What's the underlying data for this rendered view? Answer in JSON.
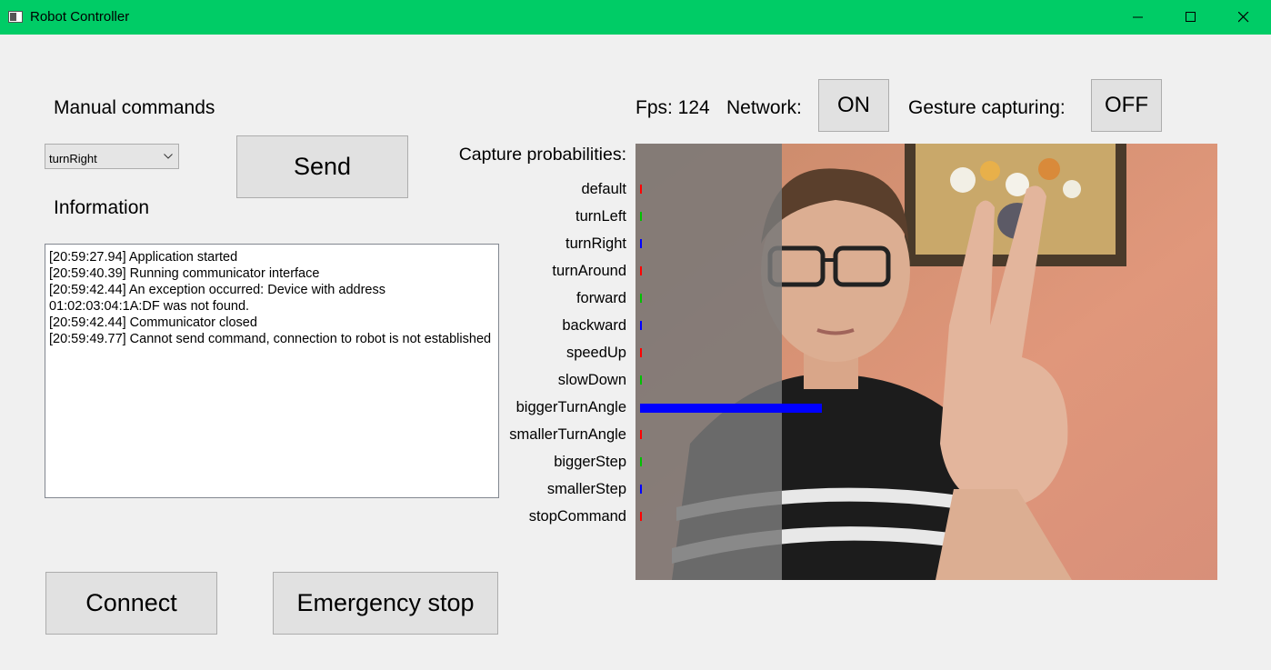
{
  "window": {
    "title": "Robot Controller"
  },
  "manual": {
    "heading": "Manual commands",
    "selected_command": "turnRight",
    "send_label": "Send"
  },
  "info": {
    "heading": "Information",
    "log": [
      "[20:59:27.94] Application started",
      "[20:59:40.39] Running communicator interface",
      "[20:59:42.44] An exception occurred: Device with address 01:02:03:04:1A:DF was not found.",
      "[20:59:42.44] Communicator closed",
      "[20:59:49.77] Cannot send command, connection to robot is not established"
    ]
  },
  "controls": {
    "connect_label": "Connect",
    "emergency_label": "Emergency stop"
  },
  "status": {
    "fps_text": "Fps: 124",
    "network_label": "Network:",
    "network_state": "ON",
    "gesture_label": "Gesture capturing:",
    "gesture_state": "OFF"
  },
  "capture": {
    "heading": "Capture probabilities:",
    "items": [
      {
        "label": "default",
        "value": 0.0,
        "color": "#ff0000"
      },
      {
        "label": "turnLeft",
        "value": 0.0,
        "color": "#00c000"
      },
      {
        "label": "turnRight",
        "value": 0.0,
        "color": "#0000ff"
      },
      {
        "label": "turnAround",
        "value": 0.0,
        "color": "#ff0000"
      },
      {
        "label": "forward",
        "value": 0.0,
        "color": "#00c000"
      },
      {
        "label": "backward",
        "value": 0.0,
        "color": "#0000ff"
      },
      {
        "label": "speedUp",
        "value": 0.0,
        "color": "#ff0000"
      },
      {
        "label": "slowDown",
        "value": 0.0,
        "color": "#00c000"
      },
      {
        "label": "biggerTurnAngle",
        "value": 1.0,
        "color": "#0000ff"
      },
      {
        "label": "smallerTurnAngle",
        "value": 0.0,
        "color": "#ff0000"
      },
      {
        "label": "biggerStep",
        "value": 0.0,
        "color": "#00c000"
      },
      {
        "label": "smallerStep",
        "value": 0.0,
        "color": "#0000ff"
      },
      {
        "label": "stopCommand",
        "value": 0.0,
        "color": "#ff0000"
      }
    ]
  },
  "camera": {
    "icon": "webcam-feed-image"
  }
}
